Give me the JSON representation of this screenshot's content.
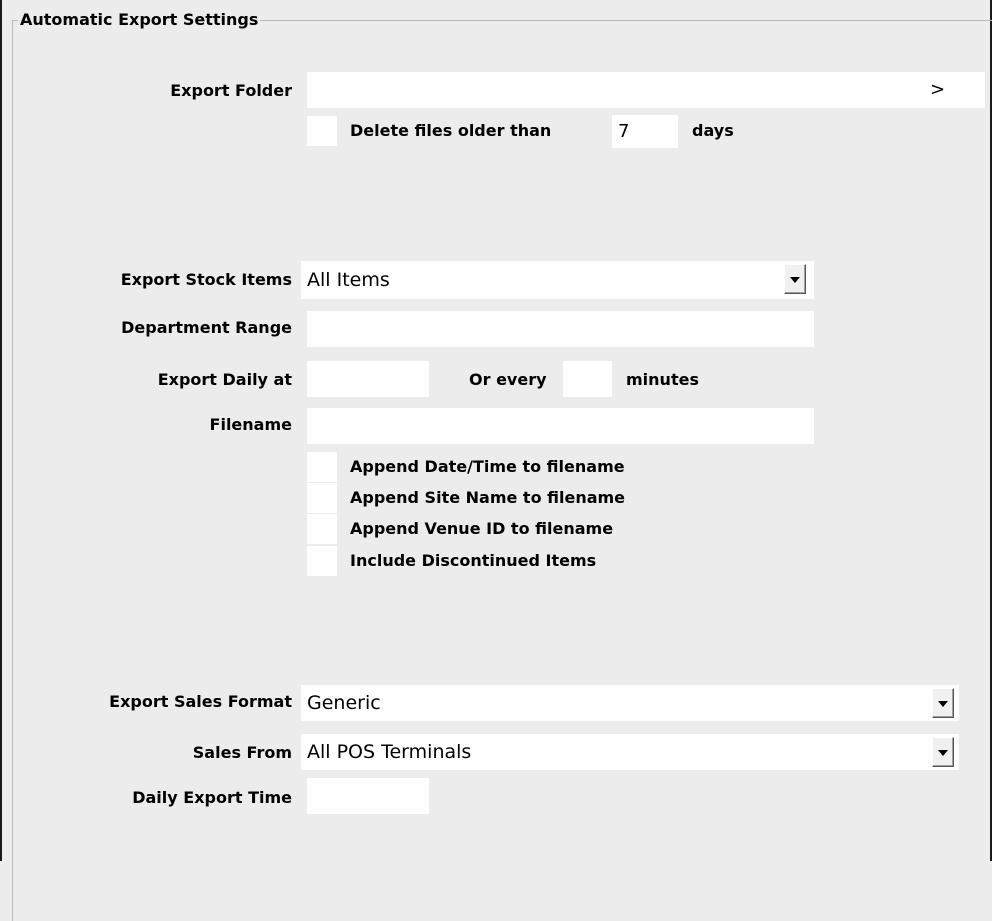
{
  "group": {
    "title": "Automatic Export Settings"
  },
  "export_folder": {
    "label": "Export Folder",
    "value": "",
    "browse_glyph": ">"
  },
  "delete_files": {
    "label": "Delete files older than",
    "days_value": "7",
    "days_label": "days",
    "checked": false
  },
  "export_stock_items": {
    "label": "Export Stock Items",
    "selected": "All Items"
  },
  "department_range": {
    "label": "Department Range",
    "value": ""
  },
  "export_daily": {
    "label": "Export Daily at",
    "value": "",
    "or_every_label": "Or every",
    "minutes_value": "",
    "minutes_label": "minutes"
  },
  "filename": {
    "label": "Filename",
    "value": ""
  },
  "options": [
    {
      "label": "Append Date/Time to filename",
      "checked": false
    },
    {
      "label": "Append Site Name to filename",
      "checked": false
    },
    {
      "label": "Append Venue ID to filename",
      "checked": false
    },
    {
      "label": "Include Discontinued Items",
      "checked": false
    }
  ],
  "export_sales_format": {
    "label": "Export Sales Format",
    "selected": "Generic"
  },
  "sales_from": {
    "label": "Sales From",
    "selected": "All POS Terminals"
  },
  "daily_export_time": {
    "label": "Daily Export Time",
    "value": ""
  },
  "icons": {
    "dropdown": "chevron-down-icon",
    "browse": "chevron-right-icon"
  }
}
